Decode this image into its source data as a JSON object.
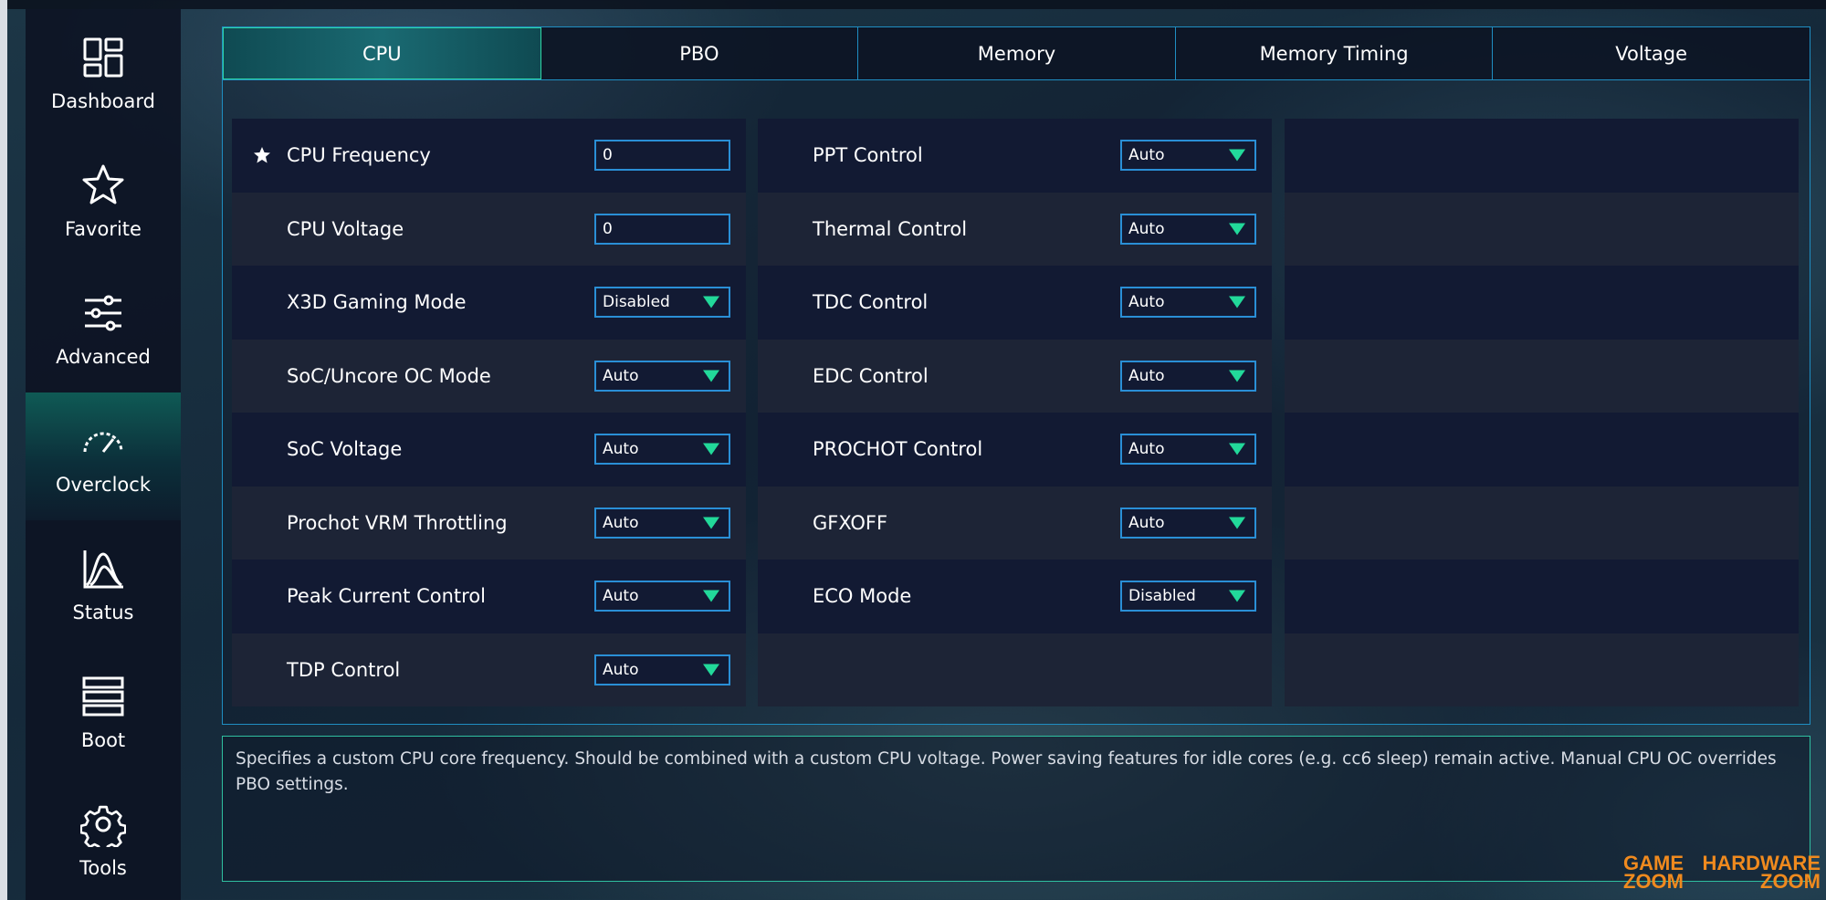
{
  "sidebar": {
    "items": [
      {
        "label": "Dashboard",
        "icon": "dashboard-icon",
        "active": false
      },
      {
        "label": "Favorite",
        "icon": "star-icon",
        "active": false
      },
      {
        "label": "Advanced",
        "icon": "sliders-icon",
        "active": false
      },
      {
        "label": "Overclock",
        "icon": "gauge-icon",
        "active": true
      },
      {
        "label": "Status",
        "icon": "chart-icon",
        "active": false
      },
      {
        "label": "Boot",
        "icon": "boot-icon",
        "active": false
      },
      {
        "label": "Tools",
        "icon": "gear-icon",
        "active": false
      }
    ]
  },
  "tabs": [
    {
      "label": "CPU",
      "active": true
    },
    {
      "label": "PBO",
      "active": false
    },
    {
      "label": "Memory",
      "active": false
    },
    {
      "label": "Memory Timing",
      "active": false
    },
    {
      "label": "Voltage",
      "active": false
    }
  ],
  "settings": {
    "column1": [
      {
        "label": "CPU Frequency",
        "type": "input",
        "value": "0",
        "favorite": true
      },
      {
        "label": "CPU Voltage",
        "type": "input",
        "value": "0"
      },
      {
        "label": "X3D Gaming Mode",
        "type": "select",
        "value": "Disabled"
      },
      {
        "label": "SoC/Uncore OC Mode",
        "type": "select",
        "value": "Auto"
      },
      {
        "label": "SoC Voltage",
        "type": "select",
        "value": "Auto"
      },
      {
        "label": "Prochot VRM Throttling",
        "type": "select",
        "value": "Auto"
      },
      {
        "label": "Peak Current Control",
        "type": "select",
        "value": "Auto"
      },
      {
        "label": "TDP Control",
        "type": "select",
        "value": "Auto"
      }
    ],
    "column2": [
      {
        "label": "PPT Control",
        "type": "select",
        "value": "Auto"
      },
      {
        "label": "Thermal Control",
        "type": "select",
        "value": "Auto"
      },
      {
        "label": "TDC Control",
        "type": "select",
        "value": "Auto"
      },
      {
        "label": "EDC Control",
        "type": "select",
        "value": "Auto"
      },
      {
        "label": "PROCHOT Control",
        "type": "select",
        "value": "Auto"
      },
      {
        "label": "GFXOFF",
        "type": "select",
        "value": "Auto"
      },
      {
        "label": "ECO Mode",
        "type": "select",
        "value": "Disabled"
      }
    ]
  },
  "help_text": "Specifies a custom CPU core frequency. Should be combined with a custom CPU voltage. Power saving features for idle cores (e.g. cc6 sleep) remain active. Manual CPU OC overrides PBO settings.",
  "watermark": {
    "game_line1": "GAME",
    "game_line2": "ZOOM",
    "hw_line1": "HARDWARE",
    "hw_line2": "ZOOM"
  },
  "colors": {
    "accent": "#22d99a",
    "tab_border": "#1f8ec2",
    "field_border": "#2a8fd6",
    "watermark": "#f08a1e"
  }
}
